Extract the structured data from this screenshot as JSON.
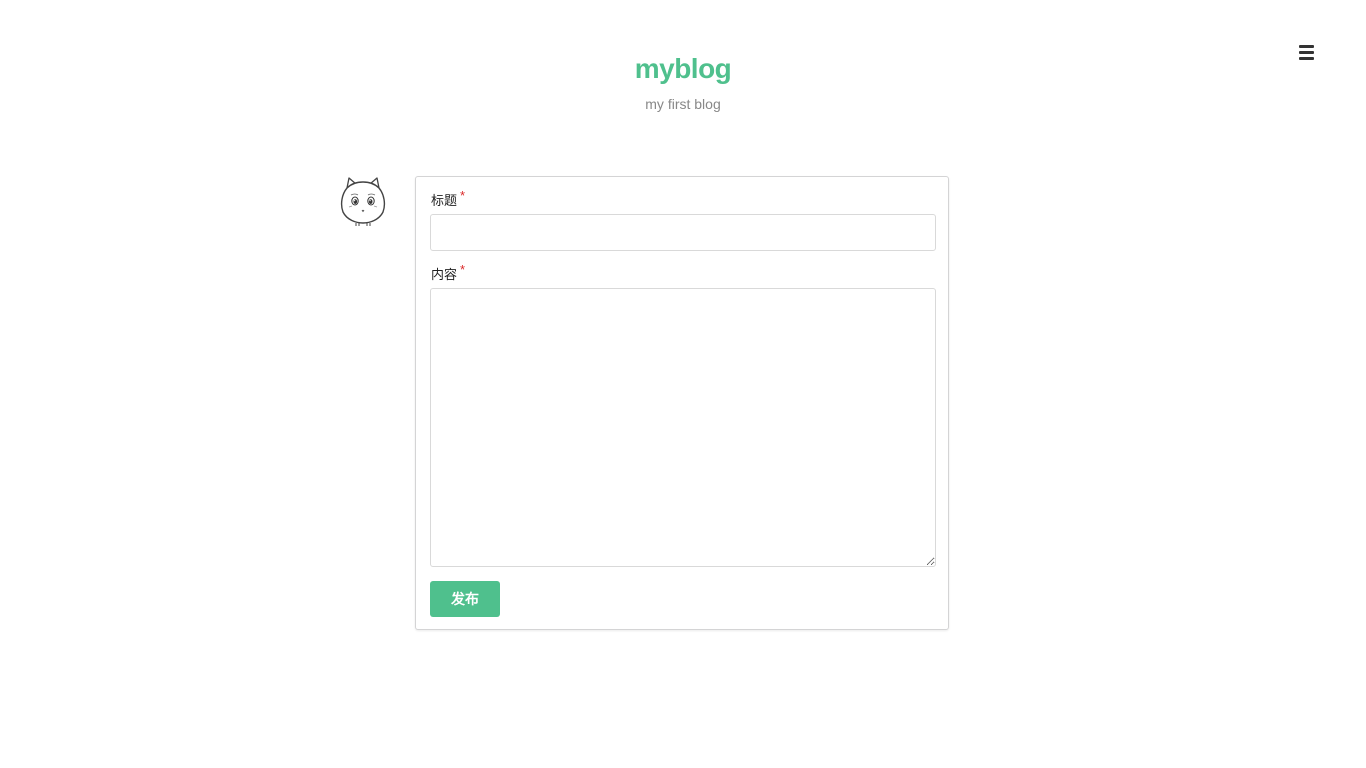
{
  "header": {
    "title": "myblog",
    "subtitle": "my first blog"
  },
  "menu": {
    "icon": "hamburger-menu-icon"
  },
  "form": {
    "title_label": "标题",
    "title_value": "",
    "content_label": "内容",
    "content_value": "",
    "required_mark": "*",
    "submit_label": "发布"
  },
  "colors": {
    "brand": "#4fc08d",
    "required": "#db2828"
  },
  "avatar": {
    "icon": "cat-avatar-icon"
  }
}
